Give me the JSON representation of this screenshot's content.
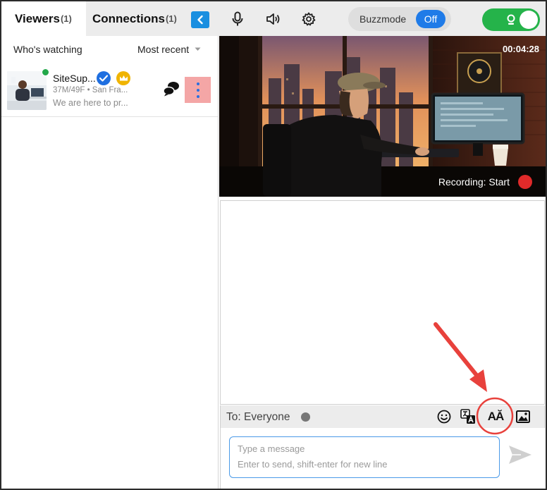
{
  "tabs": [
    {
      "label": "Viewers",
      "count": "(1)"
    },
    {
      "label": "Connections",
      "count": "(1)"
    }
  ],
  "buzzmode": {
    "label": "Buzzmode",
    "state": "Off"
  },
  "sort": {
    "label": "Who's watching",
    "selected": "Most recent"
  },
  "viewer": {
    "name": "SiteSup...",
    "meta": "37M/49F • San Fra...",
    "status": "We are here to pr..."
  },
  "video": {
    "timecode": "00:04:28",
    "recording_label": "Recording: Start"
  },
  "chat": {
    "to_label": "To: Everyone",
    "font_icon_text": "AĂ",
    "message_placeholder": "Type a message",
    "message_hint": "Enter to send, shift-enter for new line"
  },
  "colors": {
    "accent_blue": "#1f7be8",
    "toggle_green": "#25b34a",
    "recording_red": "#e02a2a",
    "annotation_red": "#e8413c"
  },
  "icons": [
    "chevron-left-icon",
    "microphone-icon",
    "speaker-icon",
    "gear-icon",
    "camera-icon",
    "chevron-down-icon",
    "verified-icon",
    "crown-icon",
    "chat-bubbles-icon",
    "more-vertical-icon",
    "emoji-icon",
    "translate-icon",
    "font-size-icon",
    "image-icon",
    "send-icon"
  ]
}
